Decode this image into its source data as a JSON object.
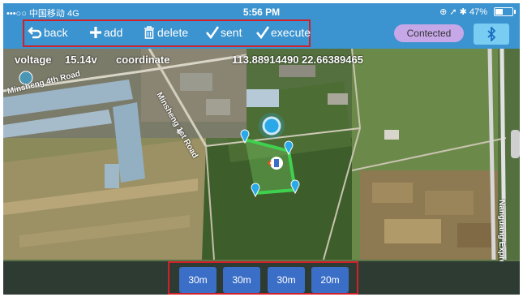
{
  "status_bar": {
    "carrier": "•••○○ 中国移动 4G",
    "time": "5:56 PM",
    "right_icons": "⊕ ➚ ✱",
    "battery_text": "47%",
    "battery_level": 0.47
  },
  "toolbar": {
    "back_label": "back",
    "add_label": "add",
    "delete_label": "delete",
    "sent_label": "sent",
    "execute_label": "execute",
    "connect_label": "Contected",
    "bluetooth_icon": "bluetooth-icon"
  },
  "map": {
    "voltage_label": "voltage",
    "voltage_value": "15.14v",
    "coordinate_label": "coordinate",
    "coordinate_value": "113.88914490 22.66389465",
    "road_labels": [
      "Minsheng 4th Road",
      "Minsheng 1st Road",
      "Nanguang Express"
    ]
  },
  "distance_buttons": [
    "30m",
    "30m",
    "30m",
    "20m"
  ],
  "colors": {
    "toolbar": "#3b93cf",
    "connect_button": "#c6a8e8",
    "bluetooth_button": "#79cdf2",
    "distance_button": "#3b6ec7",
    "highlight_border": "#d0202a",
    "path": "#3fd04f"
  }
}
